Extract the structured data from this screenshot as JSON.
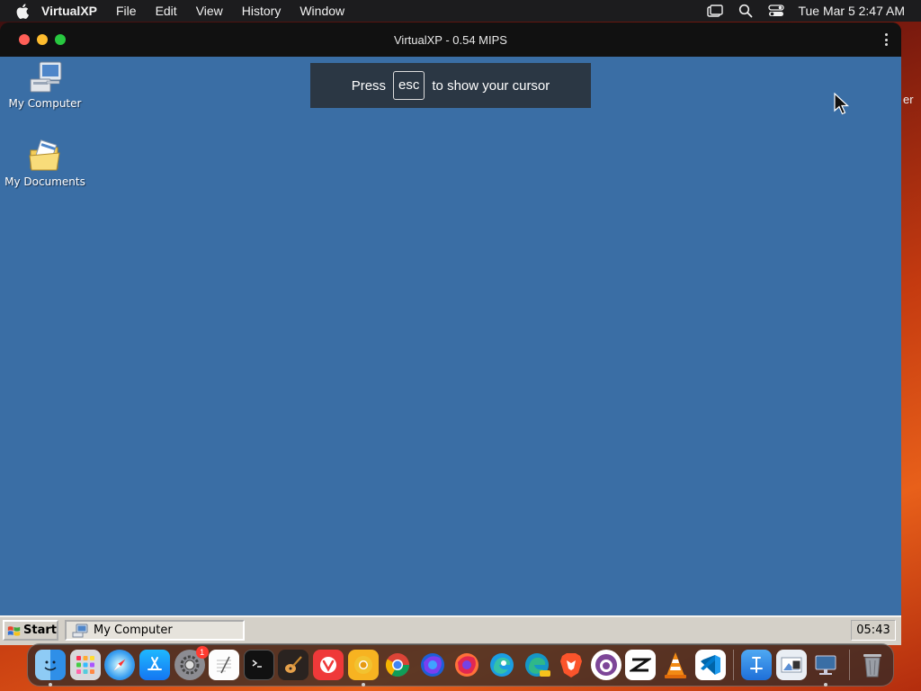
{
  "menubar": {
    "app_name": "VirtualXP",
    "items": [
      "File",
      "Edit",
      "View",
      "History",
      "Window"
    ],
    "clock": "Tue Mar 5  2:47 AM",
    "status_icons": [
      "screen-mirror-icon",
      "spotlight-search-icon",
      "control-center-icon"
    ]
  },
  "window": {
    "title": "VirtualXP - 0.54 MIPS"
  },
  "desktop": {
    "background_color": "#3a6ea5",
    "icons": [
      {
        "label": "My Computer",
        "icon": "my-computer-icon"
      },
      {
        "label": "My Documents",
        "icon": "my-documents-icon"
      }
    ],
    "toast": {
      "prefix": "Press",
      "key": "esc",
      "suffix": "to show your cursor"
    }
  },
  "taskbar": {
    "start_label": "Start",
    "tasks": [
      {
        "label": "My Computer",
        "icon": "my-computer-icon"
      }
    ],
    "clock": "05:43"
  },
  "peek": {
    "text": "er"
  },
  "dock": {
    "items": [
      {
        "name": "finder",
        "running": true
      },
      {
        "name": "launchpad",
        "running": false
      },
      {
        "name": "safari",
        "running": false
      },
      {
        "name": "app-store",
        "running": false
      },
      {
        "name": "system-settings",
        "running": false,
        "badge": "1"
      },
      {
        "name": "textedit",
        "running": false
      },
      {
        "name": "terminal",
        "running": false
      },
      {
        "name": "garageband",
        "running": false
      },
      {
        "name": "vivaldi",
        "running": false
      },
      {
        "name": "chrome-canary",
        "running": true
      },
      {
        "name": "chrome",
        "running": false
      },
      {
        "name": "firefox-dev",
        "running": false
      },
      {
        "name": "firefox",
        "running": false
      },
      {
        "name": "edge",
        "running": false
      },
      {
        "name": "edge-canary",
        "running": false
      },
      {
        "name": "brave",
        "running": false
      },
      {
        "name": "tor-browser",
        "running": false
      },
      {
        "name": "capcut",
        "running": false
      },
      {
        "name": "vlc",
        "running": false
      },
      {
        "name": "vscode",
        "running": false
      },
      {
        "name": "xcode-instruments",
        "running": false
      },
      {
        "name": "preview",
        "running": false
      },
      {
        "name": "virtualxp",
        "running": true
      },
      {
        "name": "trash",
        "running": false
      }
    ]
  }
}
